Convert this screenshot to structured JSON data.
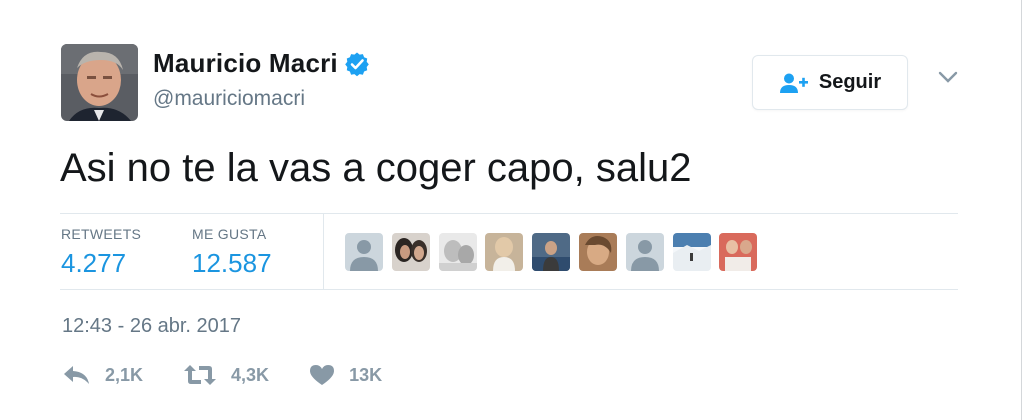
{
  "author": {
    "display_name": "Mauricio Macri",
    "handle": "@mauriciomacri",
    "verified": true
  },
  "follow_button": {
    "label": "Seguir"
  },
  "tweet": {
    "text": "Asi no te la vas a coger capo, salu2"
  },
  "stats": {
    "retweets_label": "RETWEETS",
    "retweets_value": "4.277",
    "likes_label": "ME GUSTA",
    "likes_value": "12.587"
  },
  "likers": [
    {
      "kind": "default"
    },
    {
      "kind": "photo"
    },
    {
      "kind": "photo"
    },
    {
      "kind": "photo"
    },
    {
      "kind": "photo"
    },
    {
      "kind": "photo"
    },
    {
      "kind": "default"
    },
    {
      "kind": "photo"
    },
    {
      "kind": "photo"
    }
  ],
  "timestamp": "12:43 - 26 abr. 2017",
  "actions": {
    "reply_count": "2,1K",
    "retweet_count": "4,3K",
    "like_count": "13K"
  },
  "colors": {
    "accent": "#1b95e0",
    "secondary_text": "#657786",
    "icon_gray": "#8899a6",
    "verified_blue": "#1da1f2"
  },
  "icons": [
    "verified-icon",
    "follow-user-icon",
    "chevron-down-icon",
    "reply-icon",
    "retweet-icon",
    "heart-icon"
  ]
}
